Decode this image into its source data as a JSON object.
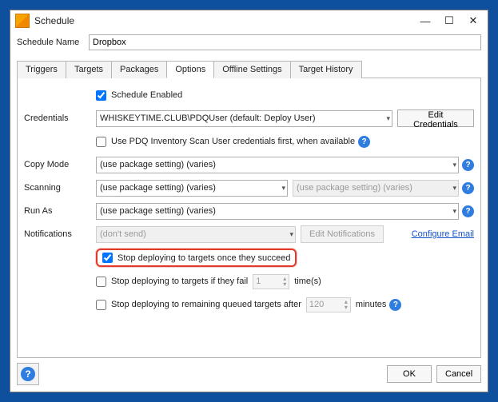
{
  "window": {
    "title": "Schedule"
  },
  "nameRow": {
    "label": "Schedule Name",
    "value": "Dropbox"
  },
  "tabs": [
    "Triggers",
    "Targets",
    "Packages",
    "Options",
    "Offline Settings",
    "Target History"
  ],
  "activeTab": "Options",
  "options": {
    "schedule_enabled_label": "Schedule Enabled",
    "credentials": {
      "label": "Credentials",
      "value": "WHISKEYTIME.CLUB\\PDQUser (default: Deploy User)",
      "edit_btn": "Edit Credentials",
      "inventory_label": "Use PDQ Inventory Scan User credentials first, when available"
    },
    "copymode": {
      "label": "Copy Mode",
      "value": "(use package setting) (varies)"
    },
    "scanning": {
      "label": "Scanning",
      "value": "(use package setting) (varies)",
      "secondary_placeholder": "(use package setting) (varies)"
    },
    "runas": {
      "label": "Run As",
      "value": "(use package setting) (varies)"
    },
    "notifications": {
      "label": "Notifications",
      "value": "(don't send)",
      "edit_btn": "Edit Notifications",
      "configure_link": "Configure Email"
    },
    "stop_succeed_label": "Stop deploying to targets once they succeed",
    "stop_fail": {
      "prefix": "Stop deploying to targets if they fail",
      "value": "1",
      "suffix": "time(s)"
    },
    "stop_remaining": {
      "prefix": "Stop deploying to remaining queued targets after",
      "value": "120",
      "suffix": "minutes"
    }
  },
  "footer": {
    "ok": "OK",
    "cancel": "Cancel"
  }
}
